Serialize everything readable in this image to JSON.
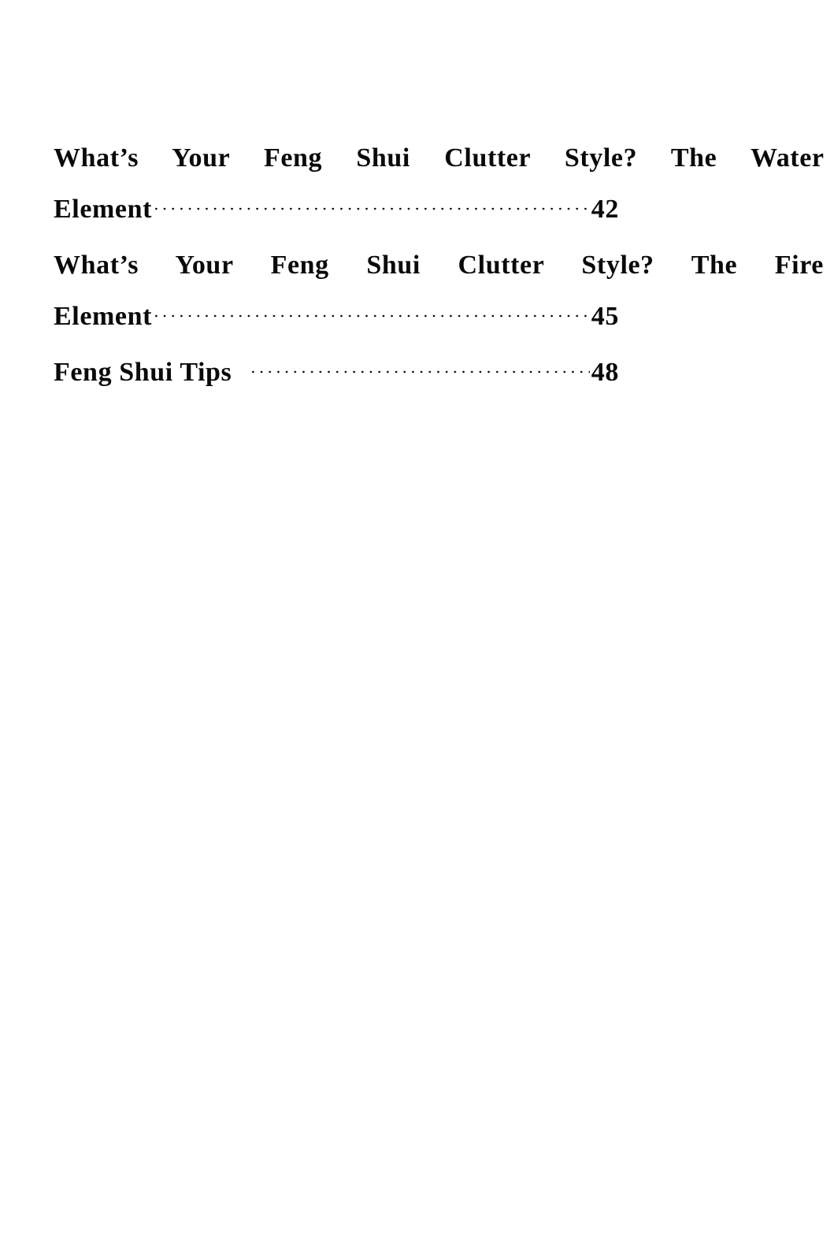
{
  "document": {
    "type": "table-of-contents",
    "page_background": "#ffffff",
    "text_color": "#0a0a0a"
  },
  "toc": {
    "entries": [
      {
        "title_lines": [
          "What’s Your Feng Shui Clutter Style? The Water",
          "Element"
        ],
        "full_title": "What’s Your Feng Shui Clutter Style? The Water Element",
        "last_line_label": "Element",
        "page": "42",
        "leader": "dot-leader"
      },
      {
        "title_lines": [
          "What’s Your Feng Shui Clutter Style? The Fire",
          "Element"
        ],
        "full_title": "What’s Your Feng Shui Clutter Style? The Fire Element",
        "last_line_label": "Element",
        "page": "45",
        "leader": "dot-leader"
      },
      {
        "title_lines": [
          "Feng Shui Tips"
        ],
        "full_title": "Feng Shui Tips",
        "last_line_label": "Feng Shui Tips ",
        "page": "48",
        "leader": "dot-leader"
      }
    ]
  }
}
